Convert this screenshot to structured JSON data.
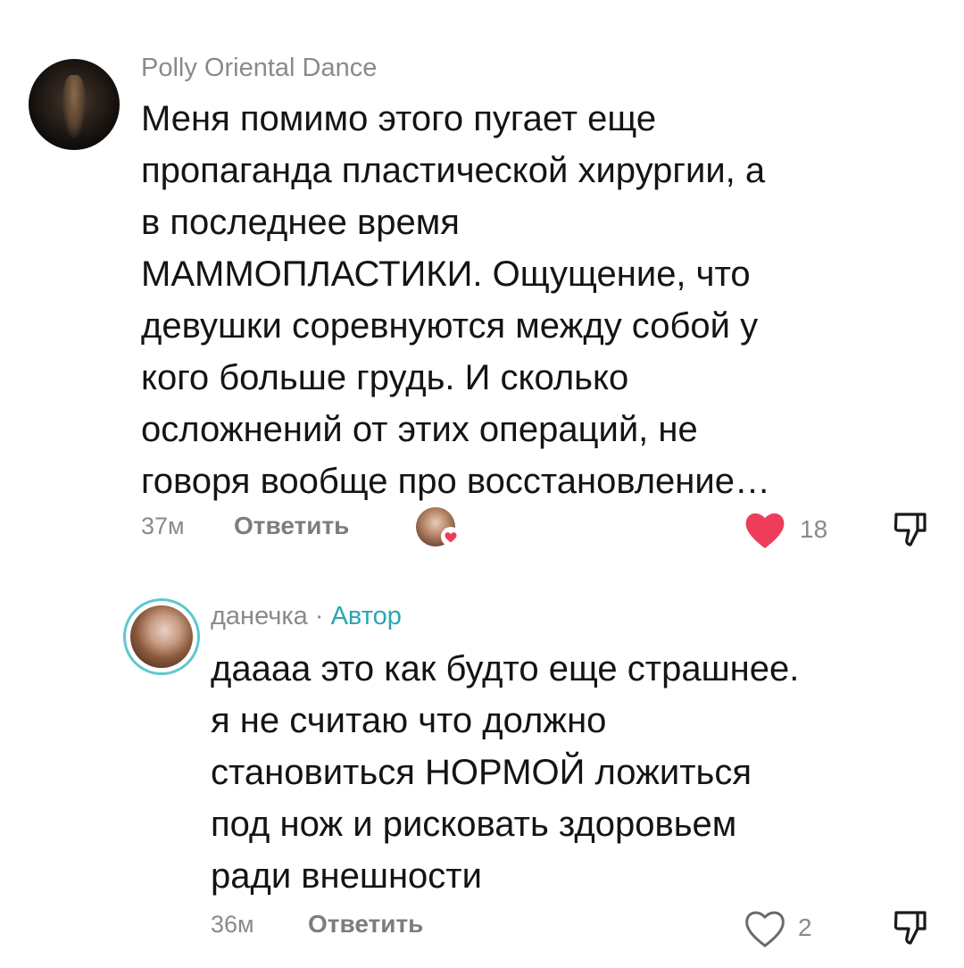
{
  "comments": [
    {
      "author": "Polly Oriental Dance",
      "text": "Меня помимо этого пугает еще\nпропаганда пластической хирургии, а\nв последнее время\nМАММОПЛАСТИКИ. Ощущение, что\nдевушки соревнуются между собой у\nкого больше грудь. И сколько\nосложнений от этих операций, не\nговоря вообще про восстановление…",
      "time": "37м",
      "reply_label": "Ответить",
      "likes": "18",
      "liked": true
    },
    {
      "author": "данечка",
      "separator": "·",
      "author_tag": "Автор",
      "text": "даааа это как будто еще страшнее.\nя не считаю что должно\nстановиться НОРМОЙ ложиться\nпод нож и рисковать здоровьем\nради внешности",
      "time": "36м",
      "reply_label": "Ответить",
      "likes": "2",
      "liked": false
    }
  ],
  "colors": {
    "heart_active": "#ee3d5b",
    "author_tag": "#2aa6b5",
    "ring": "#5ec8cf",
    "muted": "#8a8a8a"
  },
  "icons": {
    "like": "heart-icon",
    "dislike": "thumbs-down-icon",
    "creator_liked": "heart-badge-icon"
  }
}
